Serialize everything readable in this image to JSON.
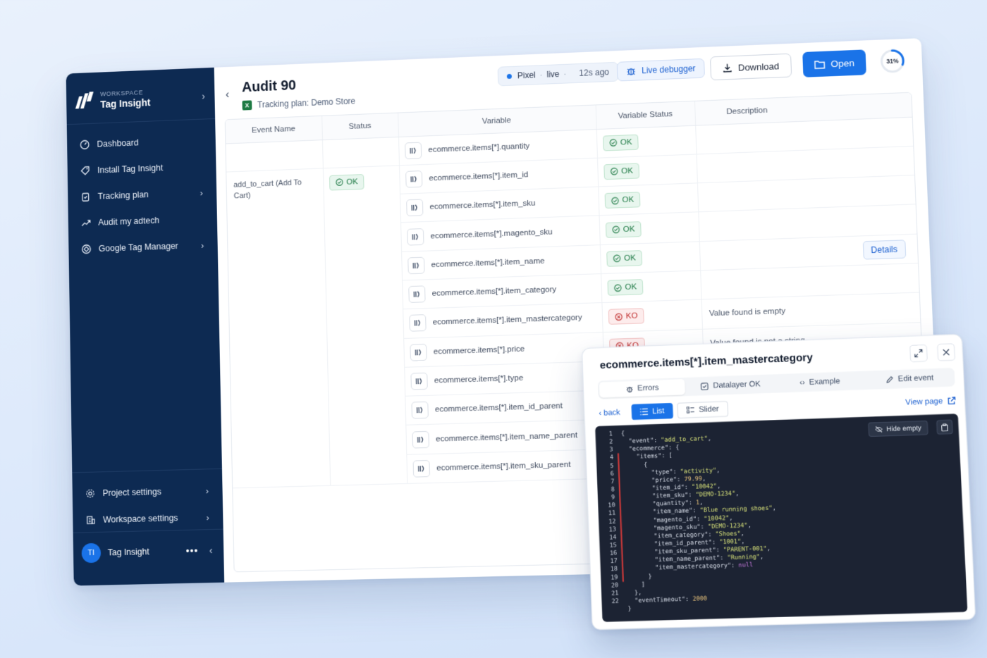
{
  "workspace": {
    "label": "WORKSPACE",
    "name": "Tag Insight"
  },
  "nav": {
    "items": [
      {
        "label": "Dashboard",
        "icon": "gauge-icon"
      },
      {
        "label": "Install Tag Insight",
        "icon": "tag-icon"
      },
      {
        "label": "Tracking plan",
        "icon": "clipboard-icon"
      },
      {
        "label": "Audit my adtech",
        "icon": "trend-icon"
      },
      {
        "label": "Google Tag Manager",
        "icon": "gtm-icon"
      }
    ],
    "bottom": [
      {
        "label": "Project settings",
        "icon": "gear-icon"
      },
      {
        "label": "Workspace settings",
        "icon": "building-icon"
      }
    ]
  },
  "user": {
    "initials": "TI",
    "name": "Tag Insight"
  },
  "header": {
    "title": "Audit 90",
    "subtitle": "Tracking plan: Demo Store",
    "pixel": {
      "label": "Pixel",
      "sep": "·",
      "state": "live",
      "ago": "12s ago"
    },
    "live_debugger": "Live debugger",
    "download": "Download",
    "open": "Open",
    "progress": {
      "value": 31,
      "label": "31%"
    }
  },
  "table": {
    "columns": [
      "Event Name",
      "Status",
      "Variable",
      "Variable Status",
      "Description"
    ],
    "event": {
      "name": "add_to_cart (Add To Cart)",
      "status": "OK"
    },
    "details_label": "Details",
    "rows": [
      {
        "variable": "ecommerce.items[*].quantity",
        "status": "OK",
        "description": ""
      },
      {
        "variable": "ecommerce.items[*].item_id",
        "status": "OK",
        "description": ""
      },
      {
        "variable": "ecommerce.items[*].item_sku",
        "status": "OK",
        "description": ""
      },
      {
        "variable": "ecommerce.items[*].magento_sku",
        "status": "OK",
        "description": ""
      },
      {
        "variable": "ecommerce.items[*].item_name",
        "status": "OK",
        "description": ""
      },
      {
        "variable": "ecommerce.items[*].item_category",
        "status": "OK",
        "description": ""
      },
      {
        "variable": "ecommerce.items[*].item_mastercategory",
        "status": "KO",
        "description": "Value found is empty"
      },
      {
        "variable": "ecommerce.items[*].price",
        "status": "KO",
        "description": "Value found is not a string"
      },
      {
        "variable": "ecommerce.items[*].type",
        "status": "",
        "description": ""
      },
      {
        "variable": "ecommerce.items[*].item_id_parent",
        "status": "",
        "description": ""
      },
      {
        "variable": "ecommerce.items[*].item_name_parent",
        "status": "",
        "description": ""
      },
      {
        "variable": "ecommerce.items[*].item_sku_parent",
        "status": "",
        "description": ""
      }
    ]
  },
  "popup": {
    "title": "ecommerce.items[*].item_mastercategory",
    "tabs": [
      "Errors",
      "Datalayer OK",
      "Example",
      "Edit event"
    ],
    "back": "back",
    "list": "List",
    "slider": "Slider",
    "view_page": "View page",
    "hide_empty": "Hide empty",
    "code_lines": [
      "{",
      "  \"event\": \"add_to_cart\",",
      "  \"ecommerce\": {",
      "    \"items\": [",
      "      {",
      "        \"type\": \"activity\",",
      "        \"price\": 79.99,",
      "        \"item_id\": \"10042\",",
      "        \"item_sku\": \"DEMO-1234\",",
      "        \"quantity\": 1,",
      "        \"item_name\": \"Blue running shoes\",",
      "        \"magento_id\": \"10042\",",
      "        \"magento_sku\": \"DEMO-1234\",",
      "        \"item_category\": \"Shoes\",",
      "        \"item_id_parent\": \"1001\",",
      "        \"item_sku_parent\": \"PARENT-001\",",
      "        \"item_name_parent\": \"Running\",",
      "        \"item_mastercategory\": null",
      "      }",
      "    ]",
      "  },",
      "  \"eventTimeout\": 2000",
      "}"
    ],
    "line_numbers": [
      "1",
      "2",
      "3",
      "4",
      "5",
      "6",
      "7",
      "8",
      "9",
      "10",
      "11",
      "12",
      "13",
      "14",
      "15",
      "16",
      "17",
      "18",
      "19",
      "20",
      "21",
      "22"
    ]
  },
  "colors": {
    "sidebar": "#0d2a52",
    "accent": "#1a73e8",
    "ok": "#1f7a45",
    "ko": "#c03030"
  }
}
